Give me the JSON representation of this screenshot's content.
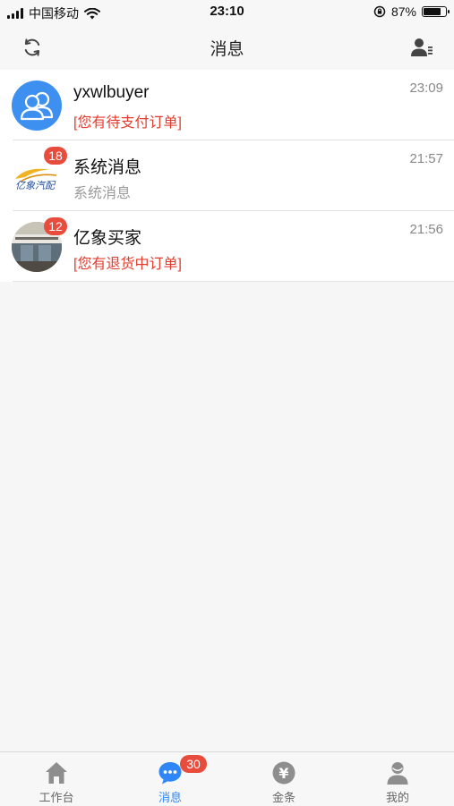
{
  "status_bar": {
    "carrier": "中国移动",
    "time": "23:10",
    "battery_text": "87%",
    "battery_level": 0.87
  },
  "nav": {
    "title": "消息",
    "left_icon": "refresh-icon",
    "right_icon": "contacts-icon"
  },
  "conversations": [
    {
      "name": "yxwlbuyer",
      "time": "23:09",
      "preview": "[您有待支付订单]",
      "preview_color": "#e23c2f",
      "avatar": "default-user-avatar",
      "badge": ""
    },
    {
      "name": "系统消息",
      "time": "21:57",
      "preview": "系统消息",
      "preview_color": "#9a9a9a",
      "avatar": "brand-logo-avatar",
      "badge": "18",
      "logo_text": "亿象汽配"
    },
    {
      "name": "亿象买家",
      "time": "21:56",
      "preview": "[您有退货中订单]",
      "preview_color": "#e23c2f",
      "avatar": "photo-avatar",
      "badge": "12"
    }
  ],
  "tabs": [
    {
      "label": "工作台",
      "icon": "home-icon",
      "active": false
    },
    {
      "label": "消息",
      "icon": "chat-bubble-icon",
      "active": true,
      "badge": "30"
    },
    {
      "label": "金条",
      "icon": "yen-coin-icon",
      "active": false,
      "icon_text": "¥"
    },
    {
      "label": "我的",
      "icon": "person-icon",
      "active": false
    }
  ],
  "colors": {
    "accent": "#2f86f6",
    "badge": "#e84c3d",
    "alert_text": "#e23c2f"
  }
}
